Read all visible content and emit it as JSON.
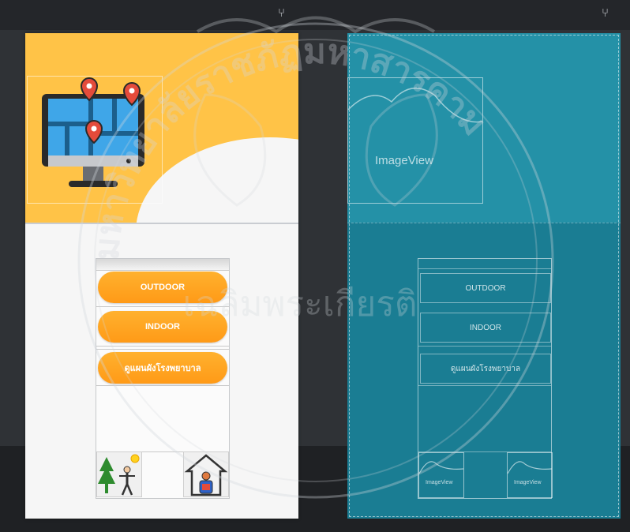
{
  "app": {
    "preview": {
      "buttons": {
        "outdoor": "OUTDOOR",
        "indoor": "INDOOR",
        "hospital": "ดูแผนผังโรงพยาบาล"
      }
    },
    "blueprint": {
      "imageview_large": "ImageView",
      "buttons": {
        "outdoor": "OUTDOOR",
        "indoor": "INDOOR",
        "hospital": "ดูแผนผังโรงพยาบาล"
      },
      "imageview_small_left": "ImageView",
      "imageview_small_right": "ImageView"
    }
  },
  "watermark": {
    "text": "มหาวิทยาลัยราชภัฏมหาสารคาม",
    "lower": "เฉลิมพระเกียรติ"
  },
  "icons": {
    "topbar": [
      "pin-icon",
      "pin-icon"
    ],
    "header": "computer-map-icon",
    "tiles": [
      "outdoor-person-icon",
      "indoor-house-icon"
    ]
  },
  "colors": {
    "header_yellow": "#ffc347",
    "button_orange": "#ff9f1c",
    "blueprint_teal": "#1a7d93",
    "editor_dark": "#2f3236"
  }
}
